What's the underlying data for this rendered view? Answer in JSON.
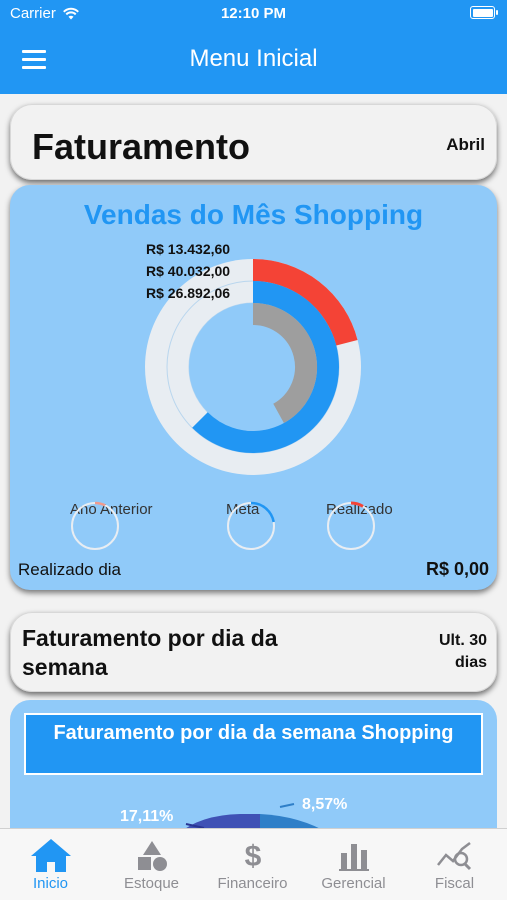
{
  "status": {
    "carrier": "Carrier",
    "time": "12:10 PM"
  },
  "nav": {
    "title": "Menu Inicial"
  },
  "faturamento": {
    "title": "Faturamento",
    "month": "Abril"
  },
  "sales_chart": {
    "title": "Vendas do Mês Shopping",
    "realizado_label": "R$ 13.432,60",
    "meta_label": "R$ 40.032,00",
    "ano_anterior_label": "R$ 26.892,06",
    "legend": [
      "Ano Anterior",
      "Meta",
      "Realizado"
    ],
    "realizado_dia_label": "Realizado dia",
    "realizado_dia_value": "R$ 0,00",
    "colors": {
      "realizado": "#f44336",
      "meta": "#2196f3",
      "ano_anterior": "#9e9e9e",
      "track": "#e8edf2"
    }
  },
  "weekday": {
    "title": "Faturamento por dia da semana",
    "period": "Ult. 30 dias",
    "banner": "Faturamento por dia da semana Shopping",
    "pct_a": "17,11%",
    "pct_b": "8,57%"
  },
  "chart_data": {
    "type": "pie",
    "title": "Vendas do Mês Shopping",
    "series": [
      {
        "name": "Realizado",
        "value": 13432.6,
        "color": "#f44336"
      },
      {
        "name": "Meta",
        "value": 40032.0,
        "color": "#2196f3"
      },
      {
        "name": "Ano Anterior",
        "value": 26892.06,
        "color": "#9e9e9e"
      }
    ]
  },
  "tabs": [
    {
      "label": "Inicio",
      "icon": "home-icon",
      "active": true
    },
    {
      "label": "Estoque",
      "icon": "shapes-icon",
      "active": false
    },
    {
      "label": "Financeiro",
      "icon": "dollar-icon",
      "active": false
    },
    {
      "label": "Gerencial",
      "icon": "bar-chart-icon",
      "active": false
    },
    {
      "label": "Fiscal",
      "icon": "chart-search-icon",
      "active": false
    }
  ]
}
